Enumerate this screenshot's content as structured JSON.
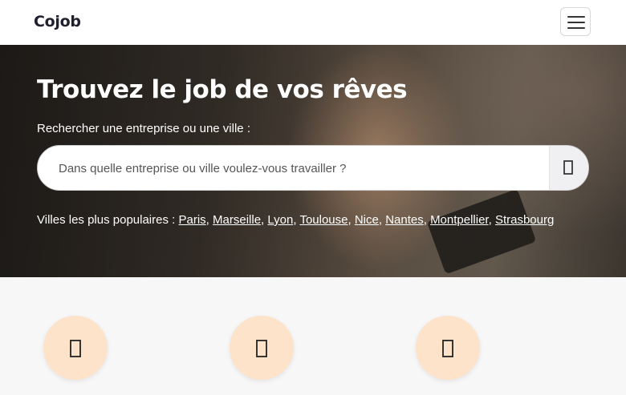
{
  "navbar": {
    "brand": "Cojob"
  },
  "hero": {
    "title": "Trouvez le job de vos rêves",
    "search_label": "Rechercher une entreprise ou une ville :",
    "search_placeholder": "Dans quelle entreprise ou ville voulez-vous travailler ?",
    "popular_label": "Villes les plus populaires : ",
    "popular_cities": [
      "Paris",
      "Marseille",
      "Lyon",
      "Toulouse",
      "Nice",
      "Nantes",
      "Montpellier",
      "Strasbourg"
    ]
  },
  "icons": {
    "search_button": "search-icon",
    "menu": "hamburger-menu-icon",
    "features": [
      "feature-icon",
      "feature-icon",
      "feature-icon"
    ]
  },
  "colors": {
    "feature_circle": "#fde3c9",
    "brand_text": "#1f1f2e"
  }
}
